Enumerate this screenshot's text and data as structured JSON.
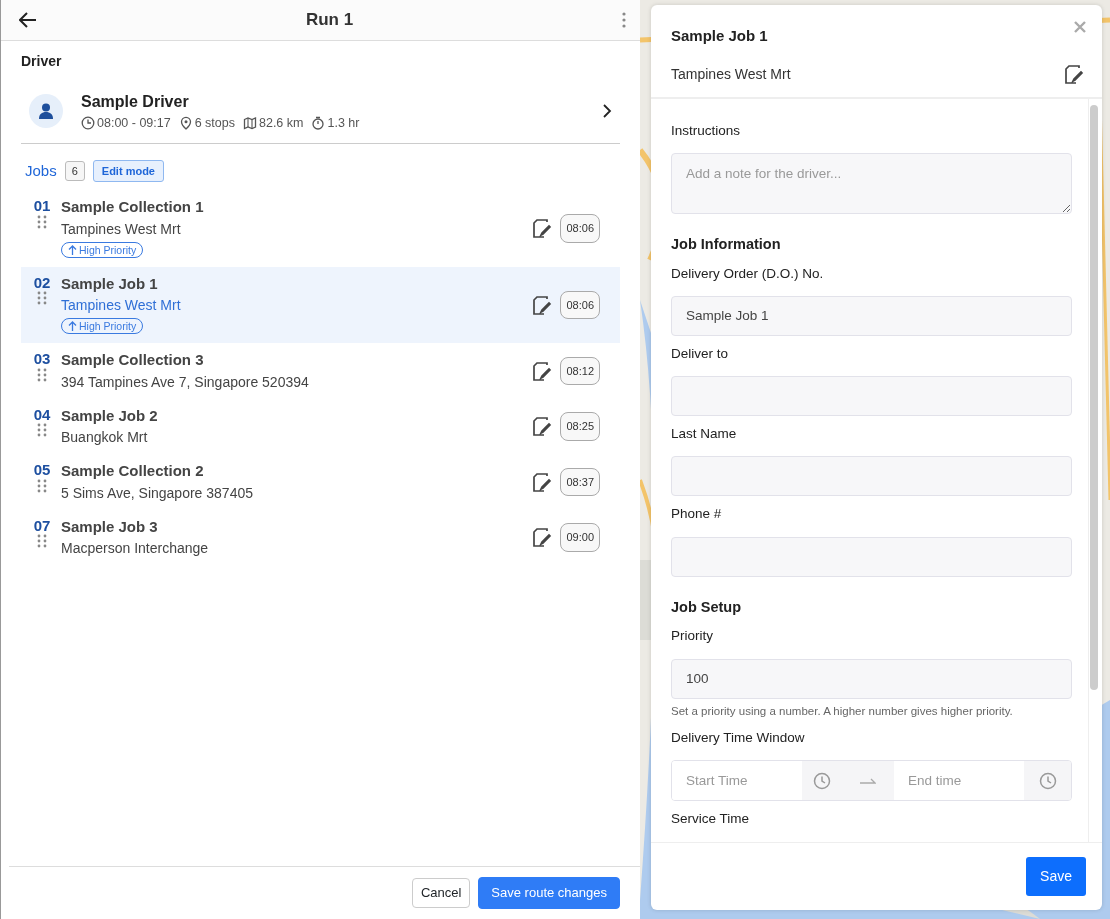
{
  "header": {
    "title": "Run 1"
  },
  "driver": {
    "section_label": "Driver",
    "name": "Sample Driver",
    "time": "08:00 - 09:17",
    "stops": "6 stops",
    "distance": "82.6 km",
    "duration": "1.3 hr"
  },
  "jobs_header": {
    "label": "Jobs",
    "count": "6",
    "edit_mode": "Edit mode"
  },
  "jobs": [
    {
      "number": "01",
      "name": "Sample Collection 1",
      "address": "Tampines West Mrt",
      "priority_tag": "High Priority",
      "selected": false,
      "time": "08:06"
    },
    {
      "number": "02",
      "name": "Sample Job 1",
      "address": "Tampines West Mrt",
      "priority_tag": "High Priority",
      "selected": true,
      "time": "08:06"
    },
    {
      "number": "03",
      "name": "Sample Collection 3",
      "address": "394 Tampines Ave 7, Singapore 520394",
      "selected": false,
      "time": "08:12"
    },
    {
      "number": "04",
      "name": "Sample Job 2",
      "address": "Buangkok Mrt",
      "selected": false,
      "time": "08:25"
    },
    {
      "number": "05",
      "name": "Sample Collection 2",
      "address": "5 Sims Ave, Singapore 387405",
      "selected": false,
      "time": "08:37"
    },
    {
      "number": "07",
      "name": "Sample Job 3",
      "address": "Macperson Interchange",
      "selected": false,
      "time": "09:00"
    }
  ],
  "footer": {
    "cancel": "Cancel",
    "save": "Save route changes"
  },
  "job_panel": {
    "title": "Sample Job 1",
    "subtitle": "Tampines West Mrt",
    "fields": [
      {
        "kind": "label",
        "text": "Instructions"
      },
      {
        "kind": "textarea",
        "placeholder": "Add a note for the driver..."
      },
      {
        "kind": "heading",
        "text": "Job Information"
      },
      {
        "kind": "label",
        "text": "Delivery Order (D.O.) No."
      },
      {
        "kind": "input",
        "value": "Sample Job 1"
      },
      {
        "kind": "label",
        "text": "Deliver to"
      },
      {
        "kind": "input"
      },
      {
        "kind": "label",
        "text": "Last Name"
      },
      {
        "kind": "input"
      },
      {
        "kind": "label",
        "text": "Phone #"
      },
      {
        "kind": "input"
      },
      {
        "kind": "heading",
        "text": "Job Setup"
      },
      {
        "kind": "label",
        "text": "Priority"
      },
      {
        "kind": "input",
        "value": "100"
      },
      {
        "kind": "help",
        "text": "Set a priority using a number. A higher number gives higher priority."
      },
      {
        "kind": "label",
        "text": "Delivery Time Window"
      },
      {
        "kind": "timerange",
        "start_placeholder": "Start Time",
        "end_placeholder": "End time"
      },
      {
        "kind": "label",
        "text": "Service Time"
      }
    ],
    "save": "Save"
  }
}
